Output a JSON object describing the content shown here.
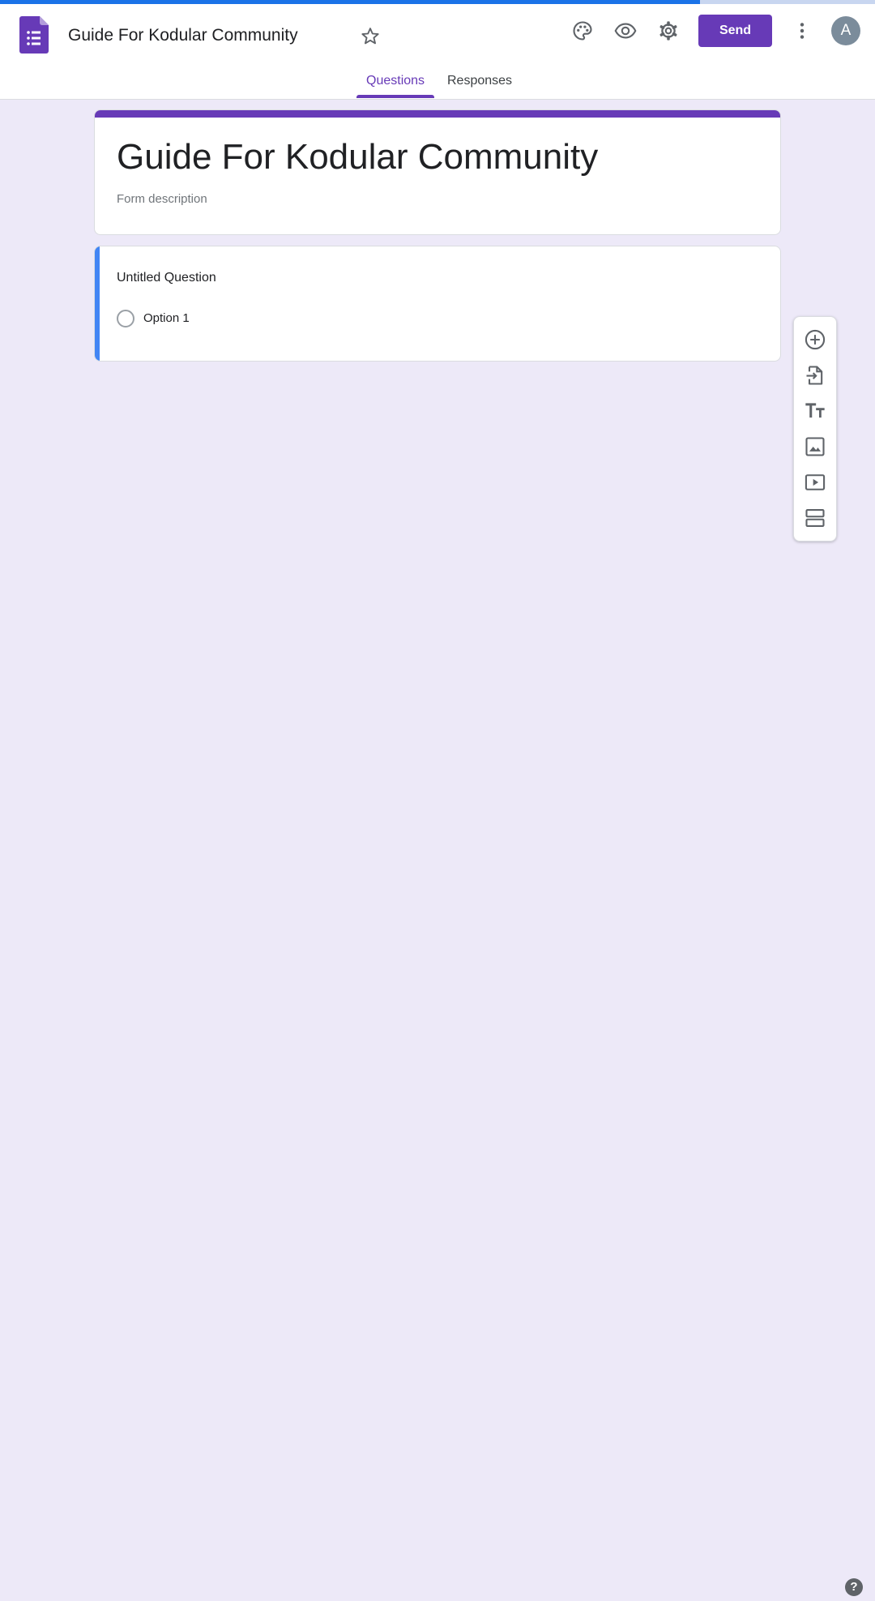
{
  "loading_progress": 0.8,
  "header": {
    "doc_title": "Guide For Kodular Community",
    "send_label": "Send",
    "avatar_initial": "A",
    "icons": [
      "forms-logo-icon",
      "star-icon",
      "palette-icon",
      "preview-eye-icon",
      "settings-gear-icon",
      "more-vert-icon"
    ]
  },
  "tabs": [
    {
      "label": "Questions",
      "active": true
    },
    {
      "label": "Responses",
      "active": false
    }
  ],
  "form": {
    "title": "Guide For Kodular Community",
    "description_placeholder": "Form description",
    "theme_color": "#673ab7",
    "background_color": "#ede9f8"
  },
  "question": {
    "title": "Untitled Question",
    "type": "multiple-choice",
    "options": [
      "Option 1"
    ],
    "accent_color": "#4285f4"
  },
  "toolbar": {
    "items": [
      "add-question-icon",
      "import-questions-icon",
      "add-title-icon",
      "add-image-icon",
      "add-video-icon",
      "add-section-icon"
    ]
  },
  "help": {
    "label": "?"
  }
}
